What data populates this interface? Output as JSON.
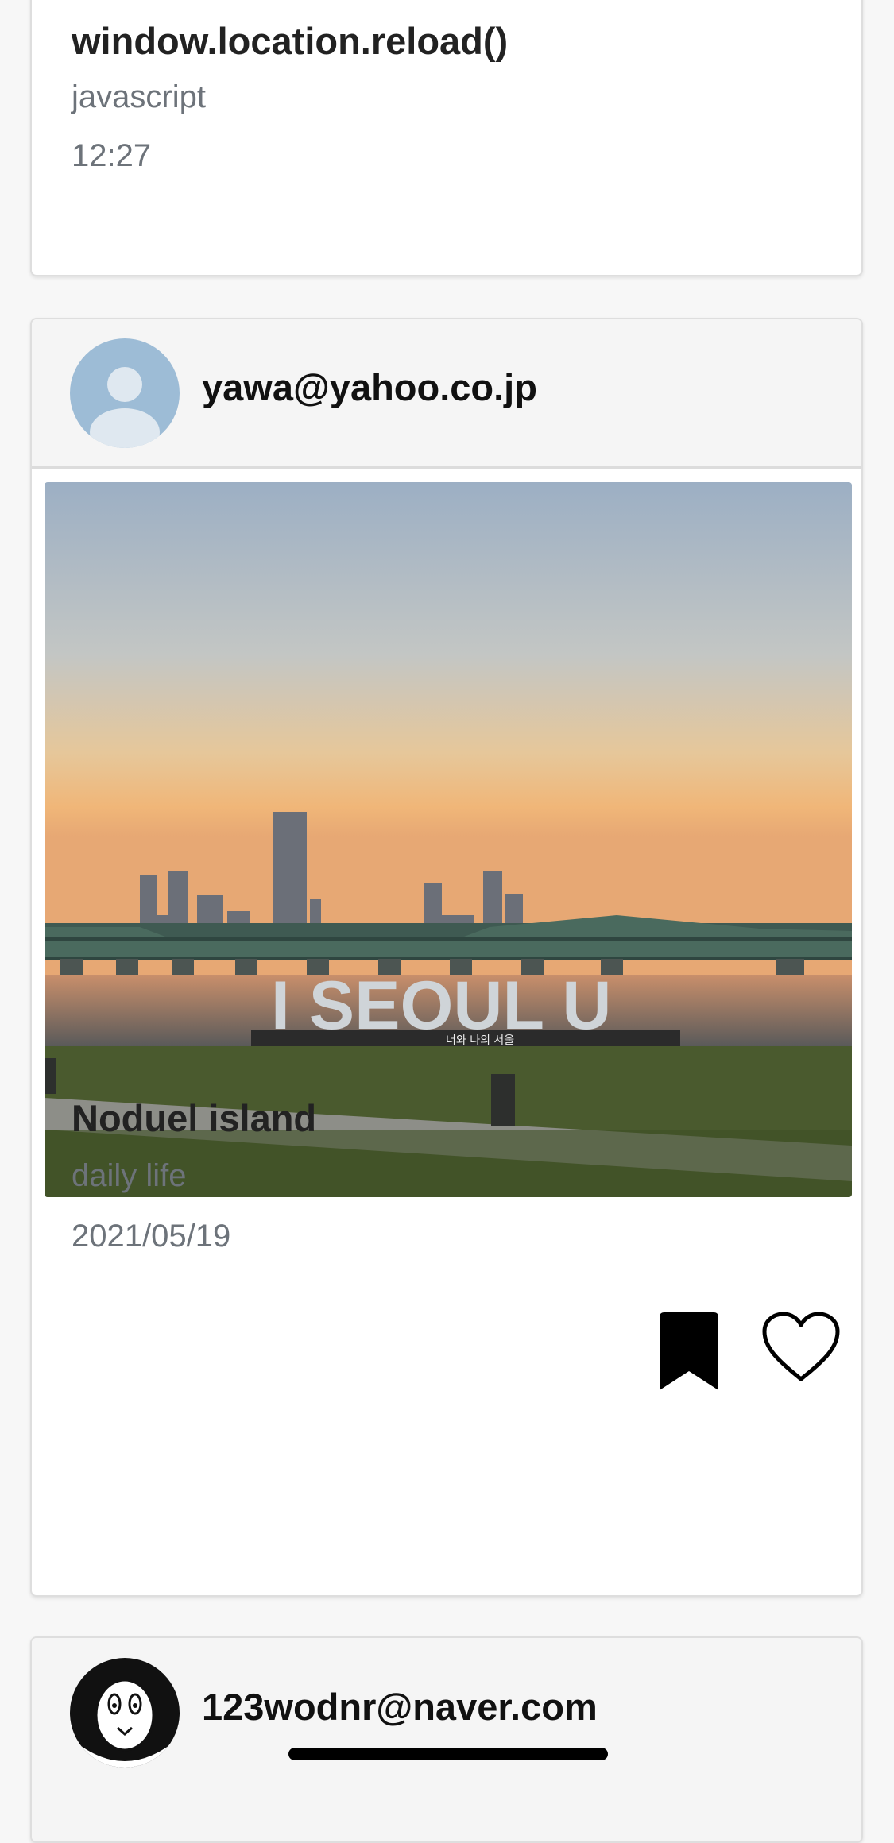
{
  "posts": [
    {
      "title": "window.location.reload()",
      "category": "javascript",
      "date": "12:27"
    },
    {
      "author": "yawa@yahoo.co.jp",
      "title": "Noduel island",
      "category": "daily life",
      "date": "2021/05/19",
      "photo": {
        "sign_text": "I SEOUL U",
        "sign_subtext": "너와 나의 서울"
      },
      "actions": {
        "bookmark_icon": "bookmark-filled-icon",
        "like_icon": "heart-outline-icon"
      }
    },
    {
      "author": "123wodnr@naver.com"
    }
  ],
  "colors": {
    "page_background": "#f7f7f7",
    "card_header": "#f5f5f5",
    "muted_text": "#6d737a"
  }
}
